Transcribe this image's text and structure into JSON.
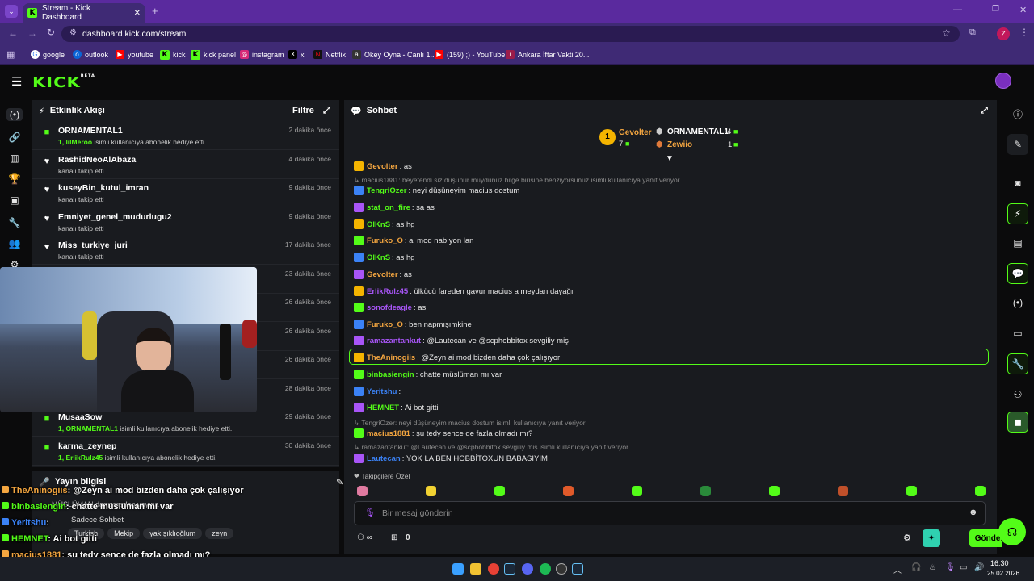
{
  "browser": {
    "tab_title": "Stream - Kick Dashboard",
    "url": "dashboard.kick.com/stream",
    "profile_initial": "Z",
    "bookmarks": [
      "google",
      "outlook",
      "youtube",
      "kick",
      "kick panel",
      "instagram",
      "x",
      "Netflix",
      "Okey Oyna - Canlı 1...",
      "(159) ;) - YouTube",
      "Ankara İftar Vakti 20..."
    ]
  },
  "app": {
    "logo": "KICK",
    "logo_sup": "BETA"
  },
  "activity": {
    "title": "Etkinlik Akışı",
    "filter_label": "Filtre",
    "items": [
      {
        "name": "ORNAMENTAL1",
        "sub_user": "1, lilMeroo",
        "sub": " isimli kullanıcıya abonelik hediye etti.",
        "time": "2 dakika önce",
        "icon": "gift-icon"
      },
      {
        "name": "RashidNeoAlAbaza",
        "sub_user": "",
        "sub": "kanalı takip etti",
        "time": "4 dakika önce",
        "icon": "heart-icon"
      },
      {
        "name": "kuseyBin_kutul_imran",
        "sub_user": "",
        "sub": "kanalı takip etti",
        "time": "9 dakika önce",
        "icon": "heart-icon"
      },
      {
        "name": "Emniyet_genel_mudurlugu2",
        "sub_user": "",
        "sub": "kanalı takip etti",
        "time": "9 dakika önce",
        "icon": "heart-icon"
      },
      {
        "name": "Miss_turkiye_juri",
        "sub_user": "",
        "sub": "kanalı takip etti",
        "time": "17 dakika önce",
        "icon": "heart-icon"
      },
      {
        "name": "",
        "sub_user": "",
        "sub": "",
        "time": "23 dakika önce",
        "icon": ""
      },
      {
        "name": "",
        "sub_user": "",
        "sub": "",
        "time": "26 dakika önce",
        "icon": ""
      },
      {
        "name": "",
        "sub_user": "",
        "sub": "",
        "time": "26 dakika önce",
        "icon": ""
      },
      {
        "name": "",
        "sub_user": "",
        "sub": "",
        "time": "26 dakika önce",
        "icon": ""
      },
      {
        "name": "",
        "sub_user": "",
        "sub": "",
        "time": "28 dakika önce",
        "icon": ""
      },
      {
        "name": "MusaaSow",
        "sub_user": "1, ORNAMENTAL1",
        "sub": " isimli kullanıcıya abonelik hediye etti.",
        "time": "29 dakika önce",
        "icon": "gift-icon"
      },
      {
        "name": "karma_zeynep",
        "sub_user": "1, ErlikRulz45",
        "sub": " isimli kullanıcıya abonelik hediye etti.",
        "time": "30 dakika önce",
        "icon": "gift-icon"
      }
    ]
  },
  "stream_info": {
    "title": "Yayın bilgisi",
    "stream_title": "MÜSLÜMAN danışmadan yayına",
    "chat_mode": "Sadece Sohbet",
    "tags": [
      "Turkish",
      "Mekip",
      "yakışıklıoğlum",
      "zeyn"
    ]
  },
  "overlay": [
    {
      "user": "TheAninogiis",
      "color": "#f4a640",
      "text": ": @Zeyn ai mod bizden daha çok çalışıyor"
    },
    {
      "user": "binbasiengin",
      "color": "#53fc18",
      "text": ": chatte müslüman mı var"
    },
    {
      "user": "Yeritshu",
      "color": "#3b82f6",
      "text": ":"
    },
    {
      "user": "HEMNET",
      "color": "#53fc18",
      "text": ": Ai bot gitti"
    },
    {
      "user": "macius1881",
      "color": "#f4a640",
      "text": ": şu tedy sence de fazla olmadı mı?"
    },
    {
      "user": "Lautecan",
      "color": "#3b82f6",
      "text": ": YOK LA BEN HOBBİTOXUN BABASIYIM"
    }
  ],
  "chat": {
    "title": "Sohbet",
    "leaderboard": {
      "first": {
        "name": "Gevolter",
        "count": "7",
        "rank": "1"
      },
      "second": {
        "name": "ORNAMENTAL1",
        "count": "4"
      },
      "third": {
        "name": "Zewiio",
        "count": "1"
      }
    },
    "messages": [
      {
        "type": "msg",
        "user": "Gevolter",
        "color": "#f4a640",
        "text": ": as"
      },
      {
        "type": "reply",
        "text": "macius1881: beyefendi siz düşünür müydünüz bilge birisine benziyorsunuz isimli kullanıcıya yanıt veriyor"
      },
      {
        "type": "msg",
        "user": "TengriOzer",
        "color": "#53fc18",
        "text": ": neyi düşüneyim macius dostum"
      },
      {
        "type": "msg",
        "user": "stat_on_fire",
        "color": "#53fc18",
        "text": ": sa as"
      },
      {
        "type": "msg",
        "user": "OlKnS",
        "color": "#53fc18",
        "text": ": as hg"
      },
      {
        "type": "msg",
        "user": "Furuko_O",
        "color": "#f4a640",
        "text": ": ai mod nabıyon lan"
      },
      {
        "type": "msg",
        "user": "OlKnS",
        "color": "#53fc18",
        "text": ": as hg"
      },
      {
        "type": "msg",
        "user": "Gevolter",
        "color": "#f4a640",
        "text": ": as"
      },
      {
        "type": "msg",
        "user": "ErlikRulz45",
        "color": "#a855f7",
        "text": ": ülkücü fareden gavur macius a meydan dayağı"
      },
      {
        "type": "msg",
        "user": "sonofdeagle",
        "color": "#a855f7",
        "text": ": as"
      },
      {
        "type": "msg",
        "user": "Furuko_O",
        "color": "#f4a640",
        "text": ": ben napmışımkine"
      },
      {
        "type": "msg",
        "user": "ramazantankut",
        "color": "#a855f7",
        "text": ": @Lautecan ve @scphobbitox sevgiliy miş"
      },
      {
        "type": "msg",
        "user": "TheAninogiis",
        "color": "#f4a640",
        "text": ": @Zeyn ai mod bizden daha çok çalışıyor"
      },
      {
        "type": "msg",
        "user": "binbasiengin",
        "color": "#53fc18",
        "text": ": chatte müslüman mı var"
      },
      {
        "type": "msg",
        "user": "Yeritshu",
        "color": "#3b82f6",
        "text": ":"
      },
      {
        "type": "msg",
        "user": "HEMNET",
        "color": "#53fc18",
        "text": ": Ai bot gitti"
      },
      {
        "type": "reply",
        "text": "TengriOzer: neyi düşüneyim macius dostum isimli kullanıcıya yanıt veriyor"
      },
      {
        "type": "msg",
        "user": "macius1881",
        "color": "#f4a640",
        "text": ": şu tedy sence de fazla olmadı mı?"
      },
      {
        "type": "reply",
        "text": "ramazantankut: @Lautecan ve @scphobbitox sevgiliy miş isimli kullanıcıya yanıt veriyor"
      },
      {
        "type": "msg",
        "user": "Lautecan",
        "color": "#3b82f6",
        "text": ": YOK LA BEN HOBBİTOXUN BABASIYIM"
      }
    ],
    "followers_emotes_label": "Takipçilere Özel",
    "input_placeholder": "Bir mesaj gönderin",
    "points_value": "0",
    "send_label": "Gönder"
  },
  "taskbar": {
    "time": "16:30",
    "date": "25.02.2026"
  },
  "colors": {
    "kick_green": "#53fc18",
    "panel": "#191b1f",
    "browser": "#3f2a75"
  }
}
